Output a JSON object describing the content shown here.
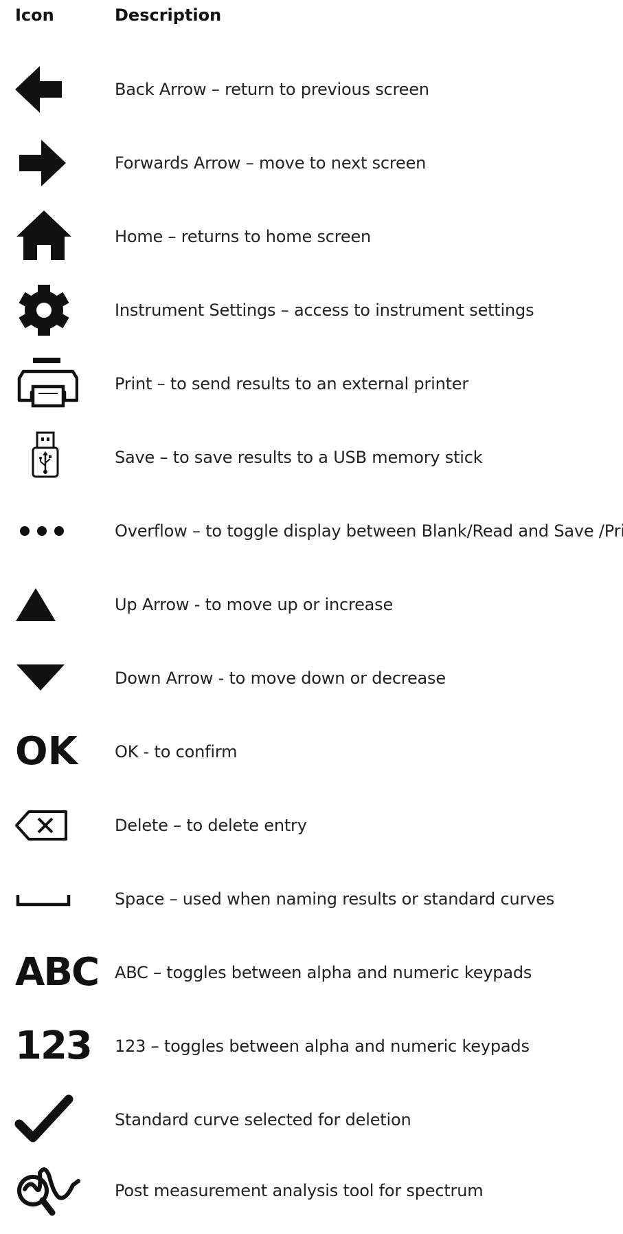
{
  "header": {
    "icon_col": "Icon",
    "desc_col": "Description"
  },
  "rows": [
    {
      "icon": "back-arrow-icon",
      "description": "Back Arrow – return to previous screen"
    },
    {
      "icon": "forwards-arrow-icon",
      "description": "Forwards Arrow – move to next screen"
    },
    {
      "icon": "home-icon",
      "description": "Home – returns to home screen"
    },
    {
      "icon": "gear-icon",
      "description": "Instrument Settings – access to instrument settings"
    },
    {
      "icon": "printer-icon",
      "description": "Print – to send results to an external printer"
    },
    {
      "icon": "usb-stick-icon",
      "description": "Save – to save results to a USB memory stick"
    },
    {
      "icon": "overflow-dots-icon",
      "description": "Overflow – to toggle display between Blank/Read and Save /Print"
    },
    {
      "icon": "up-triangle-icon",
      "description": "Up Arrow - to move up or increase"
    },
    {
      "icon": "down-triangle-icon",
      "description": "Down Arrow - to move down or decrease"
    },
    {
      "icon": "ok-text-icon",
      "icon_text": "OK",
      "description": "OK - to confirm"
    },
    {
      "icon": "delete-backspace-icon",
      "description": "Delete – to delete entry"
    },
    {
      "icon": "space-bar-icon",
      "description": "Space – used when naming results or standard curves"
    },
    {
      "icon": "abc-text-icon",
      "icon_text": "ABC",
      "description": "ABC – toggles between alpha and numeric keypads"
    },
    {
      "icon": "numeric-123-text-icon",
      "icon_text": "123",
      "description": "123 – toggles between alpha and numeric keypads"
    },
    {
      "icon": "checkmark-icon",
      "description": "Standard curve selected for deletion"
    },
    {
      "icon": "spectrum-analysis-magnifier-icon",
      "description": "Post measurement analysis tool for spectrum"
    }
  ]
}
